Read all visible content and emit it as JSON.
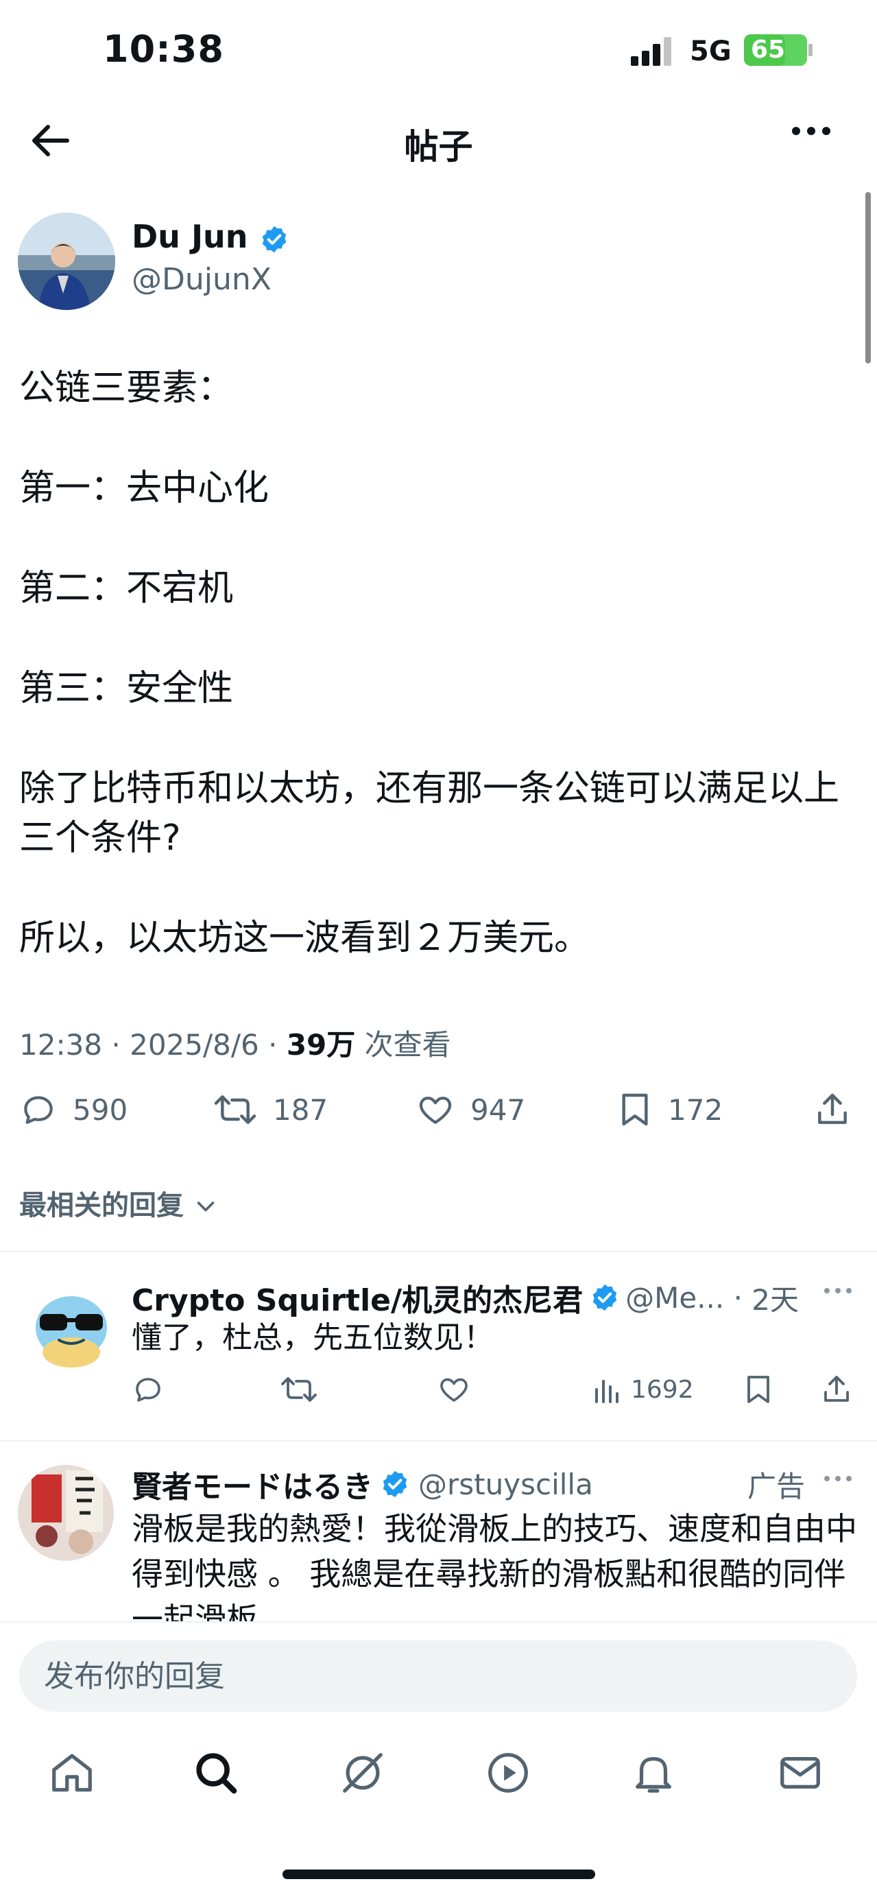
{
  "status_bar": {
    "time": "10:38",
    "network": "5G",
    "battery": "65",
    "battery_level": 0.65
  },
  "header": {
    "title": "帖子"
  },
  "post": {
    "author_name": "Du Jun",
    "author_handle": "@DujunX",
    "lines": [
      "公链三要素：",
      "第一：去中心化",
      "第二：不宕机",
      "第三：安全性",
      "除了比特币和以太坊，还有那一条公链可以满足以上三个条件?",
      "所以，以太坊这一波看到２万美元。"
    ],
    "time": "12:38",
    "date": "2025/8/6",
    "views": "39万",
    "views_suffix": "次查看",
    "replies": "590",
    "reposts": "187",
    "likes": "947",
    "bookmarks": "172"
  },
  "sort": {
    "label": "最相关的回复"
  },
  "replies": [
    {
      "name": "Crypto Squirtle/机灵的杰尼君",
      "handle": "@Me...",
      "time": "2天",
      "text": "懂了，杜总，先五位数见！",
      "views": "1692"
    },
    {
      "name": "賢者モードはるき",
      "handle": "@rstuyscilla",
      "tag": "广告",
      "text": "滑板是我的熱愛！我從滑板上的技巧、速度和自由中得到快感 。 我總是在尋找新的滑板點和很酷的同伴一起滑板"
    }
  ],
  "composer": {
    "placeholder": "发布你的回复"
  },
  "colors": {
    "accent": "#1d9bf0",
    "text": "#0f1419",
    "muted": "#536471",
    "divider": "#eff3f4"
  }
}
